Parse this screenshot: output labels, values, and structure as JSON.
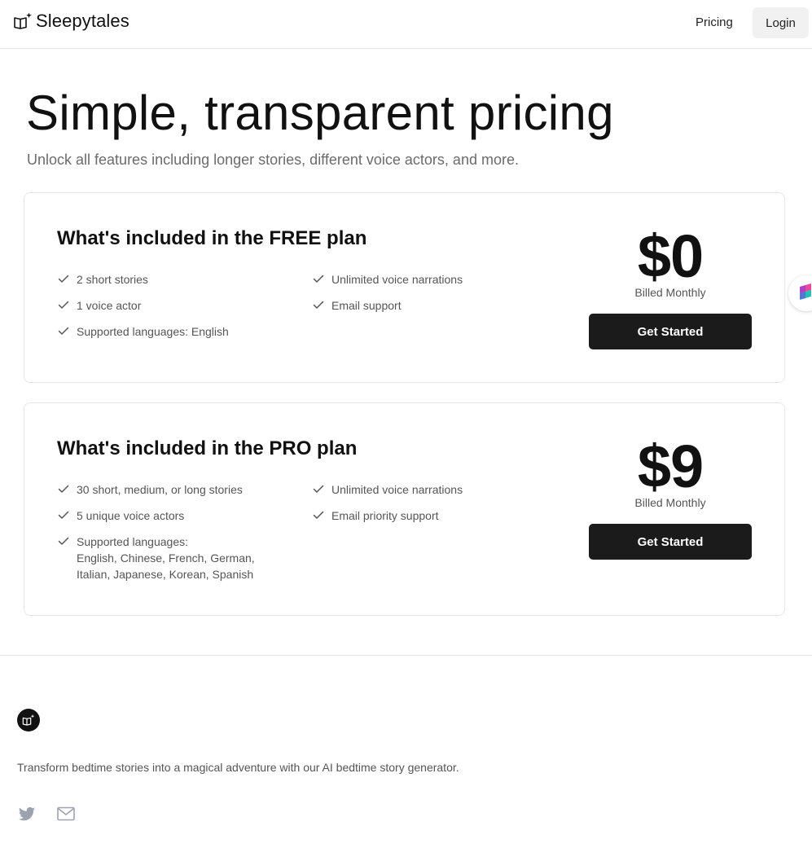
{
  "header": {
    "brand": "Sleepytales",
    "nav_pricing": "Pricing",
    "nav_login": "Login"
  },
  "hero": {
    "title": "Simple, transparent pricing",
    "subtitle": "Unlock all features including longer stories, different voice actors, and more."
  },
  "plans": [
    {
      "title": "What's included in the FREE plan",
      "features_left": [
        "2 short stories",
        "1 voice actor",
        "Supported languages: English"
      ],
      "features_right": [
        "Unlimited voice narrations",
        "Email support"
      ],
      "price": "$0",
      "billing": "Billed Monthly",
      "cta": "Get Started"
    },
    {
      "title": "What's included in the PRO plan",
      "features_left": [
        "30 short, medium, or long stories",
        "5 unique voice actors"
      ],
      "languages_label": "Supported languages:",
      "languages_line1": "English, Chinese, French, German,",
      "languages_line2": "Italian, Japanese, Korean, Spanish",
      "features_right": [
        "Unlimited voice narrations",
        "Email priority support"
      ],
      "price": "$9",
      "billing": "Billed Monthly",
      "cta": "Get Started"
    }
  ],
  "footer": {
    "tagline": "Transform bedtime stories into a magical adventure with our AI bedtime story generator.",
    "social": [
      "twitter-icon",
      "mail-icon"
    ]
  },
  "colors": {
    "primary_button": "#1b1b1b",
    "muted_text": "#6b6b6b",
    "border": "#e5e7eb",
    "login_bg": "#f1f1f1"
  }
}
